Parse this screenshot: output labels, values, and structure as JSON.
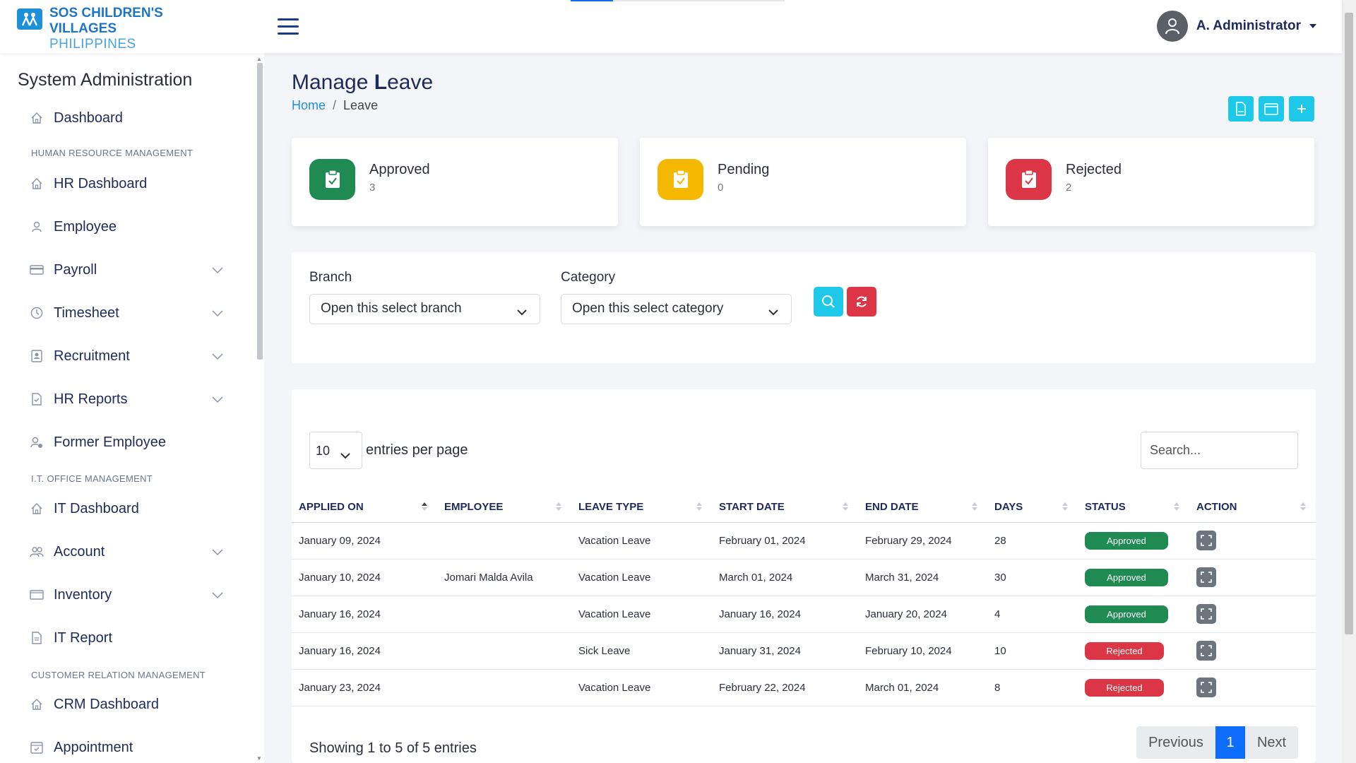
{
  "header": {
    "logo_line1": "SOS CHILDREN'S",
    "logo_line2": "VILLAGES",
    "logo_line3": "PHILIPPINES",
    "user_name": "A. Administrator"
  },
  "sidebar": {
    "title": "System Administration",
    "items": [
      {
        "label": "Dashboard",
        "icon": "home-icon"
      },
      {
        "label": "HR Dashboard",
        "icon": "home-icon"
      },
      {
        "label": "Employee",
        "icon": "user-icon"
      },
      {
        "label": "Payroll",
        "icon": "credit-card-icon"
      },
      {
        "label": "Timesheet",
        "icon": "clock-icon"
      },
      {
        "label": "Recruitment",
        "icon": "id-badge-icon"
      },
      {
        "label": "HR Reports",
        "icon": "file-check-icon"
      },
      {
        "label": "Former Employee",
        "icon": "user-gear-icon"
      },
      {
        "label": "IT Dashboard",
        "icon": "home-icon"
      },
      {
        "label": "Account",
        "icon": "users-icon"
      },
      {
        "label": "Inventory",
        "icon": "folder-icon"
      },
      {
        "label": "IT Report",
        "icon": "file-text-icon"
      },
      {
        "label": "CRM Dashboard",
        "icon": "home-icon"
      },
      {
        "label": "Appointment",
        "icon": "calendar-check-icon"
      }
    ],
    "sections": {
      "hr": "HUMAN RESOURCE MANAGEMENT",
      "it": "I.T. OFFICE MANAGEMENT",
      "crm": "CUSTOMER RELATION MANAGEMENT"
    }
  },
  "page": {
    "title_prefix": "Manage ",
    "title_bold": "L",
    "title_suffix": "eave",
    "breadcrumb_home": "Home",
    "breadcrumb_sep": "/",
    "breadcrumb_current": "Leave"
  },
  "stats": [
    {
      "label": "Approved",
      "value": "3",
      "color": "#1f8a52"
    },
    {
      "label": "Pending",
      "value": "0",
      "color": "#f5b800"
    },
    {
      "label": "Rejected",
      "value": "2",
      "color": "#dc3545"
    }
  ],
  "filters": {
    "branch_label": "Branch",
    "branch_value": "Open this select branch",
    "category_label": "Category",
    "category_value": "Open this select category"
  },
  "table": {
    "per_page": "10",
    "per_page_label": "entries per page",
    "search_placeholder": "Search...",
    "columns": [
      "APPLIED ON",
      "EMPLOYEE",
      "LEAVE TYPE",
      "START DATE",
      "END DATE",
      "DAYS",
      "STATUS",
      "ACTION"
    ],
    "rows": [
      {
        "applied": "January 09, 2024",
        "employee": "",
        "type": "Vacation Leave",
        "start": "February 01, 2024",
        "end": "February 29, 2024",
        "days": "28",
        "status": "Approved"
      },
      {
        "applied": "January 10, 2024",
        "employee": "Jomari Malda Avila",
        "type": "Vacation Leave",
        "start": "March 01, 2024",
        "end": "March 31, 2024",
        "days": "30",
        "status": "Approved"
      },
      {
        "applied": "January 16, 2024",
        "employee": "",
        "type": "Vacation Leave",
        "start": "January 16, 2024",
        "end": "January 20, 2024",
        "days": "4",
        "status": "Approved"
      },
      {
        "applied": "January 16, 2024",
        "employee": "",
        "type": "Sick Leave",
        "start": "January 31, 2024",
        "end": "February 10, 2024",
        "days": "10",
        "status": "Rejected"
      },
      {
        "applied": "January 23, 2024",
        "employee": "",
        "type": "Vacation Leave",
        "start": "February 22, 2024",
        "end": "March 01, 2024",
        "days": "8",
        "status": "Rejected"
      }
    ],
    "showing": "Showing 1 to 5 of 5 entries",
    "prev": "Previous",
    "page": "1",
    "next": "Next"
  },
  "colors": {
    "brand": "#1e74c5",
    "accent": "#1ec8e8",
    "primary": "#0d6efd",
    "approved": "#1f8a52",
    "pending": "#f5b800",
    "rejected": "#dc3545"
  }
}
